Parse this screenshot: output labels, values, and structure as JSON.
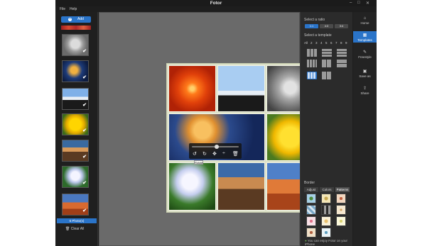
{
  "app": {
    "title": "Fotor"
  },
  "menu": {
    "file": "File",
    "help": "Help"
  },
  "sidebar": {
    "add_label": "Add",
    "photo_count": "6 Photo(s)",
    "clear_label": "Clear All",
    "thumbnails": [
      {
        "subject": "koala",
        "checked": "✔"
      },
      {
        "subject": "jellyfish",
        "checked": "✔"
      },
      {
        "subject": "penguins",
        "checked": "✔"
      },
      {
        "subject": "tulips",
        "checked": "✔"
      },
      {
        "subject": "lighthouse",
        "checked": "✔"
      },
      {
        "subject": "hydrangeas",
        "checked": "✔"
      },
      {
        "subject": "desert",
        "checked": "✔"
      }
    ]
  },
  "canvas": {
    "tooltip": "Rotate",
    "cells": [
      "chrysanthemum",
      "penguins",
      "koala",
      "jellyfish",
      "tulips",
      "hydrangeas",
      "lighthouse",
      "desert"
    ]
  },
  "right_panel": {
    "ratio_heading": "Select a ratio",
    "ratios": [
      "1:1",
      "4:3",
      "3:4"
    ],
    "selected_ratio": "1:1",
    "template_heading": "Select a template",
    "template_numbers": [
      "All",
      "2",
      "3",
      "4",
      "5",
      "6",
      "7",
      "8",
      "9"
    ],
    "border_heading": "Border",
    "border_tabs": [
      "Adjust",
      "Colors",
      "Patterns"
    ],
    "selected_border_tab": "Patterns",
    "iphone_note": "You can enjoy Fotor on your iPhone"
  },
  "nav": {
    "items": [
      "Home",
      "Templates",
      "Freestyle",
      "Save as",
      "Share"
    ],
    "selected": "Templates"
  },
  "colors": {
    "accent": "#2a74c9",
    "window_bg": "#1e1e1e",
    "canvas_bg": "#6a6a6a"
  }
}
